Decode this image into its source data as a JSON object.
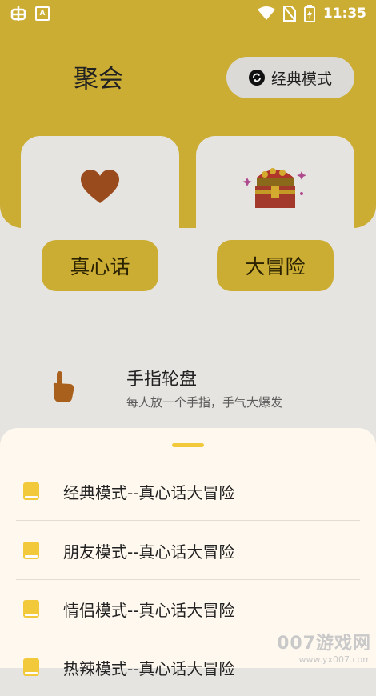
{
  "status_bar": {
    "time": "11:35",
    "notif_letter": "A"
  },
  "header": {
    "title": "聚会",
    "mode_label": "经典模式"
  },
  "cards": [
    {
      "label": "真心话",
      "icon": "heart-icon"
    },
    {
      "label": "大冒险",
      "icon": "treasure-chest-icon"
    }
  ],
  "wheel": {
    "title": "手指轮盘",
    "subtitle": "每人放一个手指，手气大爆发",
    "icon": "pointing-hand-icon"
  },
  "sheet": {
    "items": [
      {
        "label": "经典模式--真心话大冒险",
        "icon": "book-icon"
      },
      {
        "label": "朋友模式--真心话大冒险",
        "icon": "book-icon"
      },
      {
        "label": "情侣模式--真心话大冒险",
        "icon": "book-icon"
      },
      {
        "label": "热辣模式--真心话大冒险",
        "icon": "book-icon"
      }
    ]
  },
  "watermark": {
    "main": "007游戏网",
    "url": "www.yx007.com"
  },
  "colors": {
    "accent": "#ccad34",
    "sheet_bg": "#fff8ee",
    "book": "#f2c93a"
  }
}
